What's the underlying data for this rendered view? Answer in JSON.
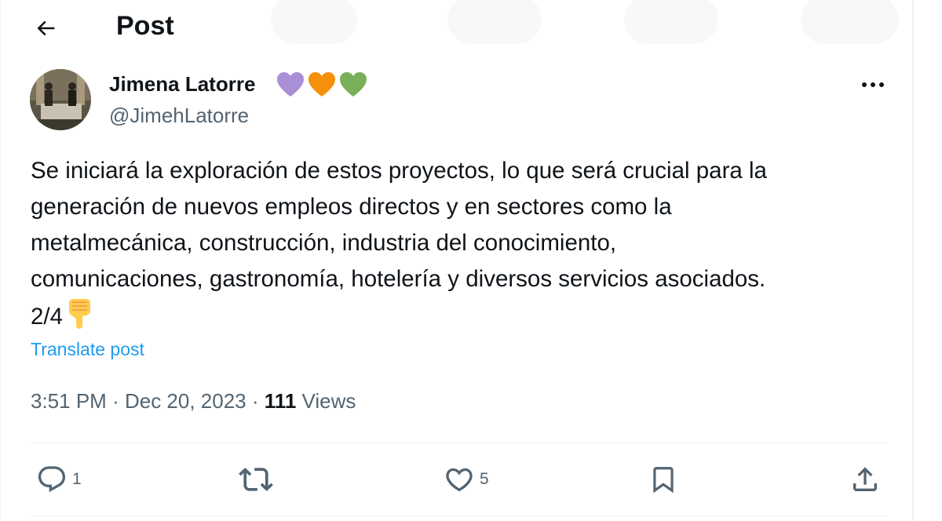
{
  "header": {
    "title": "Post",
    "back_icon": "arrow-left-icon"
  },
  "author": {
    "name": "Jimena Latorre",
    "handle": "@JimehLatorre",
    "name_emojis": [
      "purple-heart",
      "orange-heart",
      "green-heart"
    ]
  },
  "post": {
    "lines": [
      "Se iniciará la exploración de estos proyectos, lo que será crucial para la",
      "generación de nuevos empleos directos y en sectores como la",
      "metalmecánica, construcción, industria del conocimiento,",
      "comunicaciones, gastronomía, hotelería y diversos servicios asociados.",
      "2/4"
    ],
    "trailing_emoji": "backhand-index-pointing-down",
    "translate_label": "Translate post"
  },
  "meta": {
    "time": "3:51 PM",
    "date": "Dec 20, 2023",
    "separator": "·",
    "views_count": "111",
    "views_label": "Views"
  },
  "actions": {
    "reply_count": "1",
    "repost_count": "",
    "like_count": "5"
  },
  "colors": {
    "link": "#1d9bf0",
    "secondary_text": "#536471",
    "primary_text": "#0f1419"
  }
}
